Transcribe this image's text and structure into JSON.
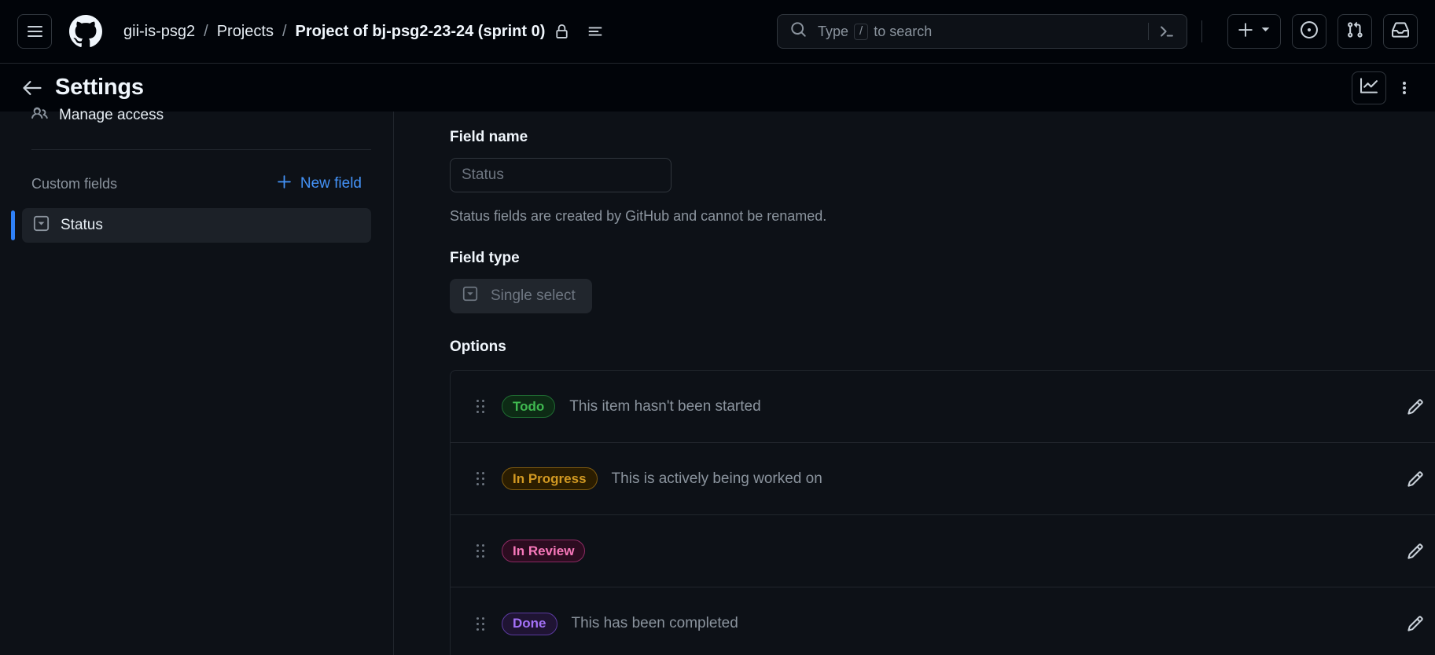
{
  "header": {
    "menu_icon": "hamburger-icon",
    "logo_icon": "github-logo",
    "breadcrumb": {
      "owner": "gii-is-psg2",
      "section": "Projects",
      "current": "Project of bj-psg2-23-24 (sprint 0)",
      "separator": "/",
      "lock_icon": "lock-icon",
      "list_icon": "list-unordered-icon"
    },
    "search": {
      "placeholder_prefix": "Type",
      "slash_key": "/",
      "placeholder_suffix": "to search",
      "search_icon": "search-icon",
      "terminal_icon": "terminal-icon"
    },
    "actions": [
      {
        "name": "create-new-button",
        "icon": "plus-icon",
        "has_caret": true
      },
      {
        "name": "issues-button",
        "icon": "issue-opened-icon"
      },
      {
        "name": "pull-requests-button",
        "icon": "git-pull-request-icon"
      },
      {
        "name": "notifications-button",
        "icon": "inbox-icon"
      }
    ]
  },
  "subheader": {
    "back_icon": "arrow-left-icon",
    "title": "Settings",
    "insights_icon": "graph-icon",
    "kebab_icon": "kebab-horizontal-icon"
  },
  "sidebar": {
    "manage_access": {
      "label": "Manage access",
      "icon": "people-icon"
    },
    "custom_fields_label": "Custom fields",
    "new_field_label": "New field",
    "new_field_icon": "plus-icon",
    "fields": [
      {
        "label": "Status",
        "icon": "single-select-icon",
        "selected": true
      }
    ]
  },
  "main": {
    "field_name_label": "Field name",
    "field_name_value": "",
    "field_name_placeholder": "Status",
    "field_name_help": "Status fields are created by GitHub and cannot be renamed.",
    "field_type_label": "Field type",
    "field_type_value": "Single select",
    "field_type_icon": "single-select-icon",
    "options_label": "Options",
    "options": [
      {
        "badge": "Todo",
        "color": "green",
        "color_hex": "#3fb950",
        "description": "This item hasn't been started",
        "edit_icon": "pencil-icon",
        "delete_icon": "x-icon"
      },
      {
        "badge": "In Progress",
        "color": "yellow",
        "color_hex": "#d29922",
        "description": "This is actively being worked on",
        "edit_icon": "pencil-icon",
        "delete_icon": "x-icon"
      },
      {
        "badge": "In Review",
        "color": "pink",
        "color_hex": "#f778ba",
        "description": "",
        "edit_icon": "pencil-icon",
        "delete_icon": "x-icon"
      },
      {
        "badge": "Done",
        "color": "purple",
        "color_hex": "#a371f7",
        "description": "This has been completed",
        "edit_icon": "pencil-icon",
        "delete_icon": "x-icon"
      }
    ]
  }
}
